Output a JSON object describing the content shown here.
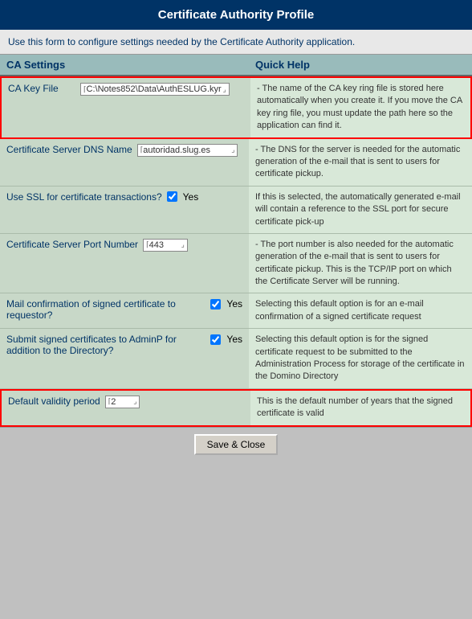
{
  "header": {
    "title": "Certificate Authority Profile"
  },
  "intro": {
    "text": "Use this form to configure settings needed by the Certificate Authority application."
  },
  "columns": {
    "settings": "CA Settings",
    "help": "Quick Help"
  },
  "rows": [
    {
      "id": "ca-key-file",
      "label": "CA Key File",
      "value": "C:\\Notes852\\Data\\AuthESLUG.kyr",
      "type": "input",
      "highlighted": true,
      "help": "- The name of the CA key ring file is stored here automatically when you create it.  If you move the CA key ring file, you must update the path here so the application can find it."
    },
    {
      "id": "cert-server-dns",
      "label": "Certificate Server DNS Name",
      "value": "autoridad.slug.es",
      "type": "input",
      "highlighted": false,
      "help": "- The DNS for the server is needed for the automatic generation of the e-mail that is sent to users for certificate pickup."
    },
    {
      "id": "use-ssl",
      "label": "Use SSL for certificate transactions?",
      "value": "Yes",
      "type": "checkbox",
      "highlighted": false,
      "help": "If this is selected, the automatically generated e-mail will contain a reference to the SSL port for secure certificate pick-up"
    },
    {
      "id": "cert-server-port",
      "label": "Certificate Server Port Number",
      "value": "443",
      "type": "input-small",
      "highlighted": false,
      "help": "- The port number is also needed for the automatic generation of the e-mail that is sent to users for certificate pickup. This is the TCP/IP port on which the Certificate Server will be running."
    },
    {
      "id": "mail-confirmation",
      "label": "Mail confirmation of signed certificate to requestor?",
      "value": "Yes",
      "type": "checkbox",
      "highlighted": false,
      "help": "Selecting this default option is for an e-mail confirmation of a signed certificate request"
    },
    {
      "id": "submit-signed",
      "label": "Submit signed certificates to AdminP for addition to the Directory?",
      "value": "Yes",
      "type": "checkbox",
      "highlighted": false,
      "help": "Selecting this default option is for the signed certificate request to be submitted to the Administration Process for storage of the certificate in the Domino Directory"
    },
    {
      "id": "default-validity",
      "label": "Default validity period",
      "value": "2",
      "type": "input-small",
      "highlighted": true,
      "help": "This is the default number of years that the signed certificate is valid"
    }
  ],
  "footer": {
    "save_button": "Save & Close"
  }
}
